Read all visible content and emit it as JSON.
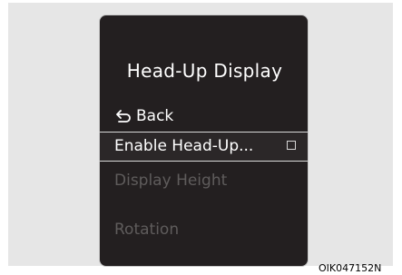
{
  "menu": {
    "title": "Head-Up Display",
    "back_label": "Back",
    "items": [
      {
        "label": "Enable Head-Up...",
        "selected": true,
        "checked": false
      },
      {
        "label": "Display Height",
        "enabled": false
      },
      {
        "label": "Rotation",
        "enabled": false
      }
    ]
  },
  "image_code": "OIK047152N",
  "icons": {
    "back": "back-arrow-icon",
    "checkbox": "checkbox-icon"
  },
  "colors": {
    "screen_background": "#231f20",
    "text": "#ffffff",
    "disabled_text": "#5f5c5c",
    "selection_border": "#d9d9d9"
  }
}
